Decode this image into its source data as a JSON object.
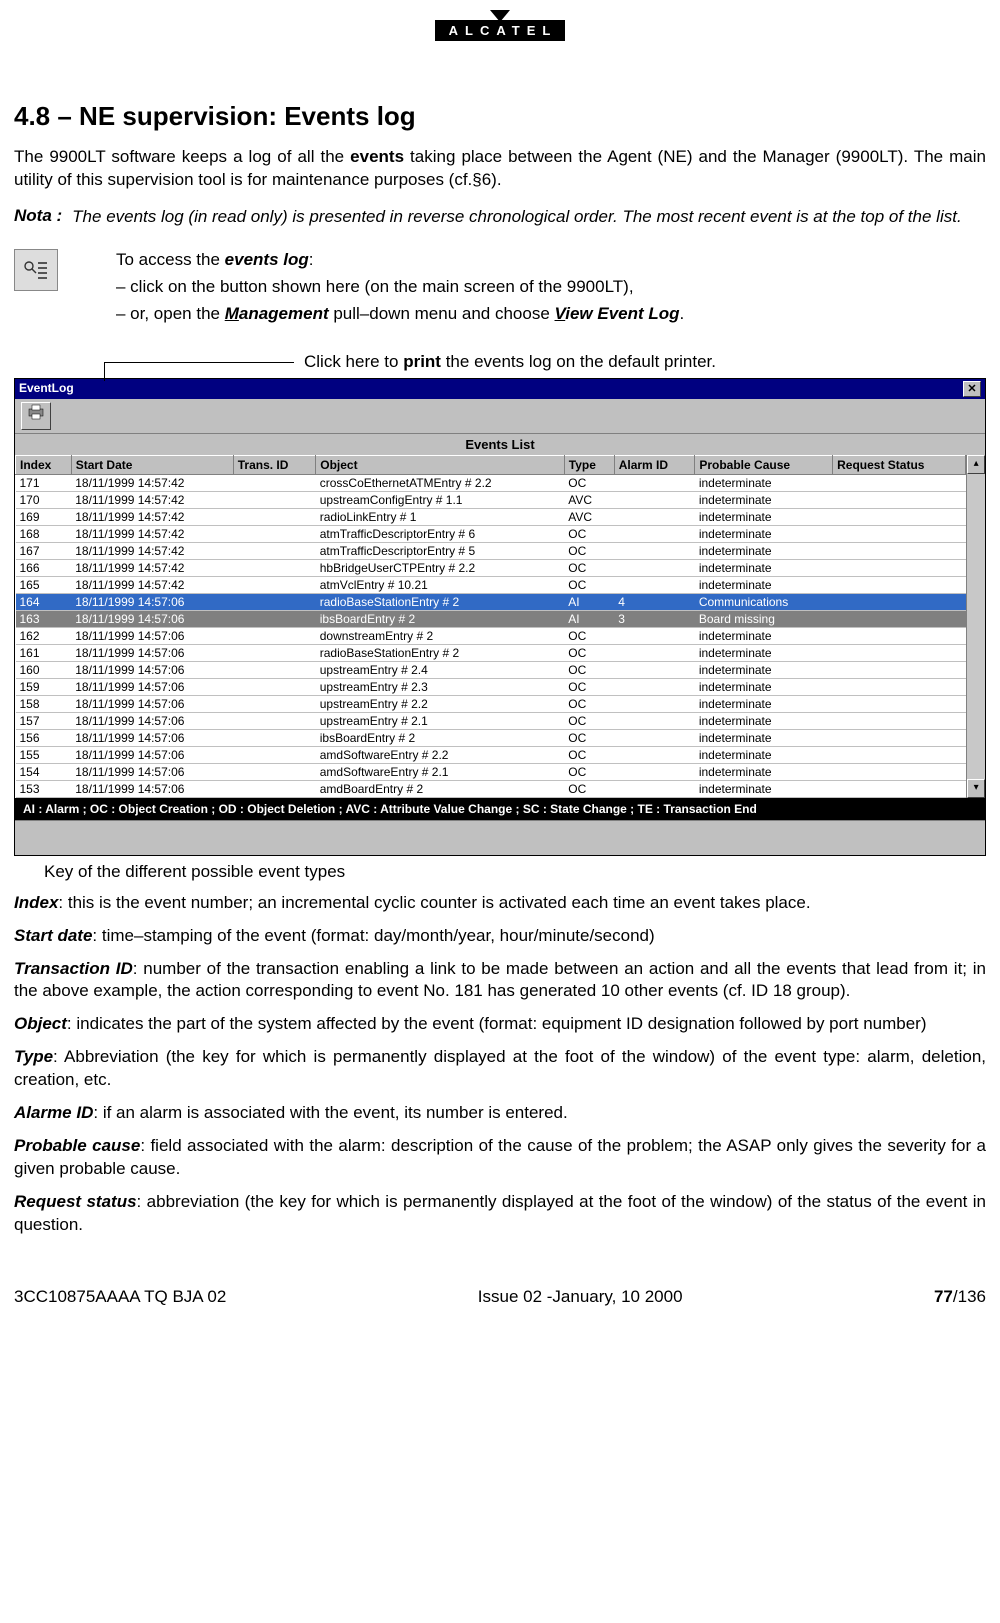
{
  "logo_text": "ALCATEL",
  "heading": "4.8 – NE supervision: Events log",
  "intro_1a": "The 9900LT software keeps a log of all the ",
  "intro_1b": "events",
  "intro_1c": " taking place between the Agent (NE) and the Manager (9900LT). The main utility of this supervision tool is for maintenance purposes (cf.§6).",
  "nota_label": "Nota :",
  "nota_text": "The events log (in read only) is presented in reverse chronological order. The most recent event is at the top of the list.",
  "access": {
    "l1a": "To access the ",
    "l1b": "events log",
    "l1c": ":",
    "l2": "– click on the button shown here (on the main screen of the 9900LT),",
    "l3a": "– or, open the ",
    "l3b_u": "M",
    "l3b_rest": "anagement",
    "l3c": " pull–down menu and choose ",
    "l3d_u": "V",
    "l3d_rest": "iew Event Log",
    "l3e": "."
  },
  "callout_print_a": "Click here to ",
  "callout_print_b": "print",
  "callout_print_c": " the events log on the default printer.",
  "window": {
    "title": "EventLog",
    "list_title": "Events List",
    "headers": [
      "Index",
      "Start Date",
      "Trans. ID",
      "Object",
      "Type",
      "Alarm ID",
      "Probable Cause",
      "Request Status"
    ],
    "rows": [
      {
        "idx": "171",
        "date": "18/11/1999 14:57:42",
        "tid": "",
        "obj": "crossCoEthernetATMEntry # 2.2",
        "type": "OC",
        "aid": "",
        "cause": "indeterminate",
        "rs": ""
      },
      {
        "idx": "170",
        "date": "18/11/1999 14:57:42",
        "tid": "",
        "obj": "upstreamConfigEntry # 1.1",
        "type": "AVC",
        "aid": "",
        "cause": "indeterminate",
        "rs": ""
      },
      {
        "idx": "169",
        "date": "18/11/1999 14:57:42",
        "tid": "",
        "obj": "radioLinkEntry # 1",
        "type": "AVC",
        "aid": "",
        "cause": "indeterminate",
        "rs": ""
      },
      {
        "idx": "168",
        "date": "18/11/1999 14:57:42",
        "tid": "",
        "obj": "atmTrafficDescriptorEntry # 6",
        "type": "OC",
        "aid": "",
        "cause": "indeterminate",
        "rs": ""
      },
      {
        "idx": "167",
        "date": "18/11/1999 14:57:42",
        "tid": "",
        "obj": "atmTrafficDescriptorEntry # 5",
        "type": "OC",
        "aid": "",
        "cause": "indeterminate",
        "rs": ""
      },
      {
        "idx": "166",
        "date": "18/11/1999 14:57:42",
        "tid": "",
        "obj": "hbBridgeUserCTPEntry # 2.2",
        "type": "OC",
        "aid": "",
        "cause": "indeterminate",
        "rs": ""
      },
      {
        "idx": "165",
        "date": "18/11/1999 14:57:42",
        "tid": "",
        "obj": "atmVclEntry # 10.21",
        "type": "OC",
        "aid": "",
        "cause": "indeterminate",
        "rs": ""
      },
      {
        "idx": "164",
        "date": "18/11/1999 14:57:06",
        "tid": "",
        "obj": "radioBaseStationEntry # 2",
        "type": "AI",
        "aid": "4",
        "cause": "Communications",
        "rs": "",
        "sel": "sel1"
      },
      {
        "idx": "163",
        "date": "18/11/1999 14:57:06",
        "tid": "",
        "obj": "ibsBoardEntry # 2",
        "type": "AI",
        "aid": "3",
        "cause": "Board missing",
        "rs": "",
        "sel": "sel2"
      },
      {
        "idx": "162",
        "date": "18/11/1999 14:57:06",
        "tid": "",
        "obj": "downstreamEntry # 2",
        "type": "OC",
        "aid": "",
        "cause": "indeterminate",
        "rs": ""
      },
      {
        "idx": "161",
        "date": "18/11/1999 14:57:06",
        "tid": "",
        "obj": "radioBaseStationEntry # 2",
        "type": "OC",
        "aid": "",
        "cause": "indeterminate",
        "rs": ""
      },
      {
        "idx": "160",
        "date": "18/11/1999 14:57:06",
        "tid": "",
        "obj": "upstreamEntry # 2.4",
        "type": "OC",
        "aid": "",
        "cause": "indeterminate",
        "rs": ""
      },
      {
        "idx": "159",
        "date": "18/11/1999 14:57:06",
        "tid": "",
        "obj": "upstreamEntry # 2.3",
        "type": "OC",
        "aid": "",
        "cause": "indeterminate",
        "rs": ""
      },
      {
        "idx": "158",
        "date": "18/11/1999 14:57:06",
        "tid": "",
        "obj": "upstreamEntry # 2.2",
        "type": "OC",
        "aid": "",
        "cause": "indeterminate",
        "rs": ""
      },
      {
        "idx": "157",
        "date": "18/11/1999 14:57:06",
        "tid": "",
        "obj": "upstreamEntry # 2.1",
        "type": "OC",
        "aid": "",
        "cause": "indeterminate",
        "rs": ""
      },
      {
        "idx": "156",
        "date": "18/11/1999 14:57:06",
        "tid": "",
        "obj": "ibsBoardEntry # 2",
        "type": "OC",
        "aid": "",
        "cause": "indeterminate",
        "rs": ""
      },
      {
        "idx": "155",
        "date": "18/11/1999 14:57:06",
        "tid": "",
        "obj": "amdSoftwareEntry # 2.2",
        "type": "OC",
        "aid": "",
        "cause": "indeterminate",
        "rs": ""
      },
      {
        "idx": "154",
        "date": "18/11/1999 14:57:06",
        "tid": "",
        "obj": "amdSoftwareEntry # 2.1",
        "type": "OC",
        "aid": "",
        "cause": "indeterminate",
        "rs": ""
      },
      {
        "idx": "153",
        "date": "18/11/1999 14:57:06",
        "tid": "",
        "obj": "amdBoardEntry # 2",
        "type": "OC",
        "aid": "",
        "cause": "indeterminate",
        "rs": ""
      }
    ],
    "key_text": "AI : Alarm ; OC : Object Creation ; OD : Object Deletion ; AVC : Attribute Value Change ; SC : State Change ; TE : Transaction End"
  },
  "callout_key": "Key of the different possible event types",
  "fields": [
    {
      "lbl": "Index",
      "txt": ": this is the event number; an incremental cyclic counter is activated each time an event takes place."
    },
    {
      "lbl": "Start date",
      "txt": ": time–stamping of the event (format: day/month/year, hour/minute/second)"
    },
    {
      "lbl": "Transaction ID",
      "txt": ": number of the transaction enabling a link to be made between an action and all the events that lead from it; in the above example, the action corresponding to event No. 181 has generated 10 other events (cf. ID 18 group)."
    },
    {
      "lbl": "Object",
      "txt": ": indicates the part of the system affected by the event (format: equipment ID designation followed by port number)"
    },
    {
      "lbl": "Type",
      "txt": ": Abbreviation (the key for which is permanently displayed at the foot of the window) of the event type: alarm, deletion, creation, etc."
    },
    {
      "lbl": "Alarme ID",
      "txt": ": if an alarm is associated with the event, its number is entered."
    },
    {
      "lbl": "Probable cause",
      "txt": ": field associated with the alarm: description of the cause of the problem; the ASAP only gives the severity for a given probable cause."
    },
    {
      "lbl": "Request status",
      "txt": ": abbreviation (the key for which is permanently displayed at the foot of the window) of the status of the event in question."
    }
  ],
  "footer": {
    "left": "3CC10875AAAA TQ BJA 02",
    "center": "Issue 02 -January, 10 2000",
    "page": "77",
    "total": "/136"
  }
}
